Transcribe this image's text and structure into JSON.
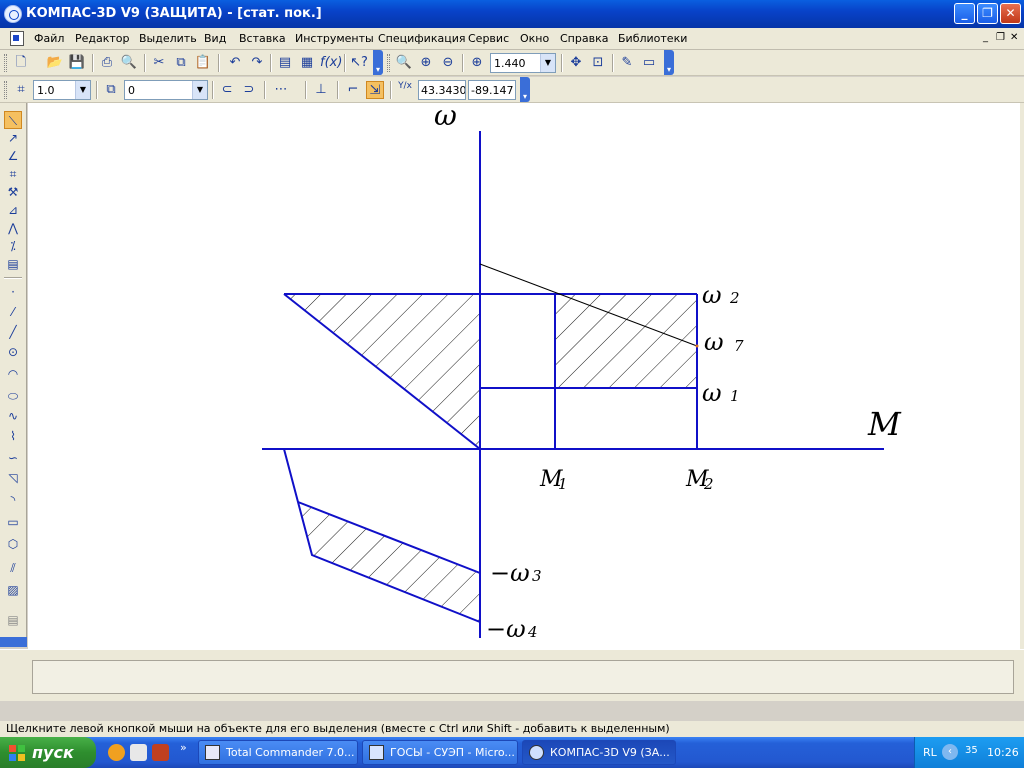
{
  "window": {
    "title": "КОМПАС-3D V9 (ЗАЩИТА) - [стат. пок.]",
    "min_label": "_",
    "max_label": "❐",
    "close_label": "✕"
  },
  "menu": {
    "items": [
      "Файл",
      "Редактор",
      "Выделить",
      "Вид",
      "Вставка",
      "Инструменты",
      "Спецификация",
      "Сервис",
      "Окно",
      "Справка",
      "Библиотеки"
    ],
    "mdi_min": "_",
    "mdi_restore": "❐",
    "mdi_close": "✕"
  },
  "toolbar1": {
    "zoom_value": "1.440"
  },
  "toolbar2": {
    "line_width": "1.0",
    "layer": "0",
    "coord_label": "Y/x",
    "coord_x": "43.3430",
    "coord_y": "-89.147"
  },
  "drawing": {
    "axis_y_label": "ω",
    "axis_x_label": "M",
    "labels": {
      "w2": "ω",
      "w2_sub": "2",
      "w7": "ω",
      "w7_sub": "7",
      "w1": "ω",
      "w1_sub": "1",
      "w3": "−ω",
      "w3_sub": "3",
      "w4": "−ω",
      "w4_sub": "4",
      "m1": "M",
      "m1_sub": "1",
      "m2": "M",
      "m2_sub": "2"
    },
    "line_color": "#1010c8",
    "hatch_color": "#000000"
  },
  "status": {
    "hint": "Щелкните левой кнопкой мыши на объекте для его выделения (вместе с Ctrl или Shift - добавить к выделенным)"
  },
  "taskbar": {
    "start_label": "пуск",
    "tasks": [
      {
        "label": "Total Commander 7.0...",
        "icon": "total-commander-icon"
      },
      {
        "label": "ГОСЫ - СУЭП - Micro...",
        "icon": "word-icon"
      },
      {
        "label": "КОМПАС-3D V9 (ЗА...",
        "icon": "kompas-icon"
      }
    ],
    "overflow": "»",
    "tray_lang": "RL",
    "tray_chevron": "‹",
    "tray_volume": "35",
    "clock": "10:26"
  }
}
